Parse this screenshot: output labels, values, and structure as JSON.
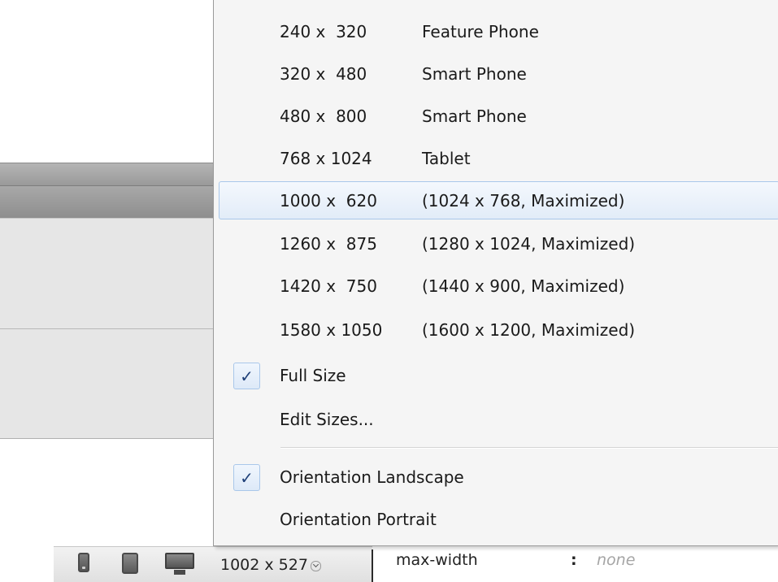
{
  "menu": {
    "sizes": [
      {
        "dim": "240 x  320",
        "desc": "Feature Phone"
      },
      {
        "dim": "320 x  480",
        "desc": "Smart Phone"
      },
      {
        "dim": "480 x  800",
        "desc": "Smart Phone"
      },
      {
        "dim": "768 x 1024",
        "desc": "Tablet"
      },
      {
        "dim": "1000 x  620",
        "desc": "(1024 x 768, Maximized)"
      },
      {
        "dim": "1260 x  875",
        "desc": "(1280 x 1024, Maximized)"
      },
      {
        "dim": "1420 x  750",
        "desc": "(1440 x 900, Maximized)"
      },
      {
        "dim": "1580 x 1050",
        "desc": "(1600 x 1200, Maximized)"
      }
    ],
    "highlighted_item": "1000 x  620",
    "full_size": {
      "label": "Full Size",
      "checked": true
    },
    "edit_sizes": {
      "label": "Edit Sizes..."
    },
    "orientation_landscape": {
      "label": "Orientation Landscape",
      "checked": true
    },
    "orientation_portrait": {
      "label": "Orientation Portrait",
      "checked": false
    },
    "check_glyph": "✓"
  },
  "status_bar": {
    "device_icons": [
      "mobile-phone-icon",
      "tablet-icon",
      "desktop-icon"
    ],
    "window_size": "1002 x 527",
    "css_property": {
      "name": "max-width",
      "colon": ":",
      "value": "none"
    }
  },
  "colors": {
    "highlight_border": "#a9c7ea",
    "highlight_fill": "#e2ecf8",
    "menu_background": "#f5f5f5",
    "check_color": "#1e3f78"
  }
}
